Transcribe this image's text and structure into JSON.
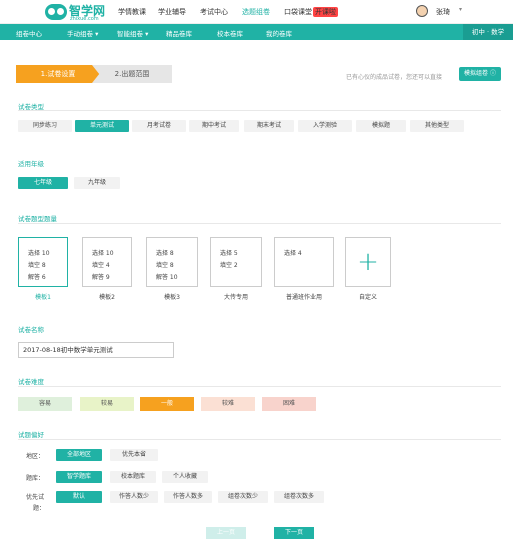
{
  "header": {
    "logo_title": "智学网",
    "logo_sub": "zhixue.com",
    "nav": [
      "学情教课",
      "学业辅导",
      "考试中心",
      "选题组卷",
      "口袋课堂"
    ],
    "hot_badge": "开课啦",
    "user_name": "张琦",
    "caret": "▾"
  },
  "mainnav": {
    "items": [
      "组卷中心",
      "手动组卷 ▾",
      "智能组卷 ▾",
      "精品卷库",
      "校本卷库",
      "我的卷库"
    ],
    "grade": "初中 · 数学"
  },
  "steps": {
    "step1": "1.试卷设置",
    "step2": "2.出题范围"
  },
  "hint": "已有心仪的成品试卷，您还可以直接",
  "mock_button": "模拟组卷 ⓘ",
  "paper_type": {
    "title": "试卷类型",
    "options": [
      "同步练习",
      "单元测试",
      "月考试卷",
      "期中考试",
      "期末考试",
      "入学测验",
      "模拟题",
      "其他类型"
    ]
  },
  "grade_section": {
    "title": "适用年级",
    "options": [
      "七年级",
      "九年级"
    ]
  },
  "question_quantity": {
    "title": "试卷题型题量",
    "templates": [
      {
        "name": "模板1",
        "lines": [
          "选择  10",
          "填空  8",
          "解答  6"
        ]
      },
      {
        "name": "模板2",
        "lines": [
          "选择  10",
          "填空  4",
          "解答  9"
        ]
      },
      {
        "name": "模板3",
        "lines": [
          "选择  8",
          "填空  8",
          "解答  10"
        ]
      },
      {
        "name": "大传专用",
        "lines": [
          "选择  5",
          "填空  2",
          ""
        ]
      },
      {
        "name": "普通班作业用",
        "lines": [
          "选择  4",
          "",
          ""
        ]
      }
    ],
    "custom_label": "自定义",
    "add_symbol": "+"
  },
  "paper_name": {
    "title": "试卷名称",
    "value": "2017-08-18初中数学单元测试"
  },
  "difficulty": {
    "title": "试卷难度",
    "options": [
      {
        "label": "容易",
        "color": "#dff0dc"
      },
      {
        "label": "较易",
        "color": "#e8f3c8"
      },
      {
        "label": "一般",
        "color": "#f6a11f"
      },
      {
        "label": "较难",
        "color": "#fbe0d4"
      },
      {
        "label": "困难",
        "color": "#f8d3cc"
      }
    ]
  },
  "preference": {
    "title": "试题偏好",
    "region_label": "地区：",
    "region_options": [
      "全部地区",
      "优先本省"
    ],
    "bank_label": "题库：",
    "bank_options": [
      "智学题库",
      "校本题库",
      "个人收藏"
    ],
    "priority_label": "优先试",
    "priority_label2": "题：",
    "priority_options": [
      "默认",
      "作答人数少",
      "作答人数多",
      "组卷次数少",
      "组卷次数多"
    ]
  },
  "pagination": {
    "prev": "上一页",
    "next": "下一页"
  },
  "colors": {
    "accent": "#20b2a5",
    "orange": "#f6a11f"
  }
}
